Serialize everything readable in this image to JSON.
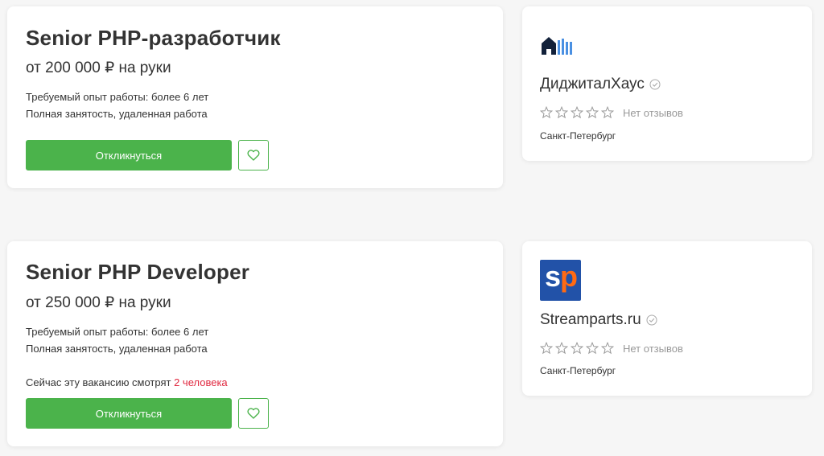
{
  "vacancies": [
    {
      "title": "Senior PHP-разработчик",
      "salary": "от 200 000 ₽ на руки",
      "experience": "Требуемый опыт работы: более 6 лет",
      "employment": "Полная занятость, удаленная работа",
      "apply_label": "Откликнуться",
      "company": {
        "name": "ДиджиталХаус",
        "logo_icon": "house-logo-icon",
        "rating_stars": 0,
        "reviews_text": "Нет отзывов",
        "city": "Санкт-Петербург"
      }
    },
    {
      "title": "Senior PHP Developer",
      "salary": "от 250 000 ₽ на руки",
      "experience": "Требуемый опыт работы: более 6 лет",
      "employment": "Полная занятость, удаленная работа",
      "watchers_prefix": "Сейчас эту вакансию смотрят",
      "watchers_count": "2 человека",
      "apply_label": "Откликнуться",
      "company": {
        "name": "Streamparts.ru",
        "logo_text_1": "s",
        "logo_text_2": "p",
        "rating_stars": 0,
        "reviews_text": "Нет отзывов",
        "city": "Санкт-Петербург"
      }
    }
  ],
  "colors": {
    "accent_green": "#4bb34b",
    "watchers_red": "#e0283f",
    "muted_text": "#999999",
    "sp_logo_blue": "#2252a8",
    "sp_logo_orange": "#ff6a13"
  }
}
